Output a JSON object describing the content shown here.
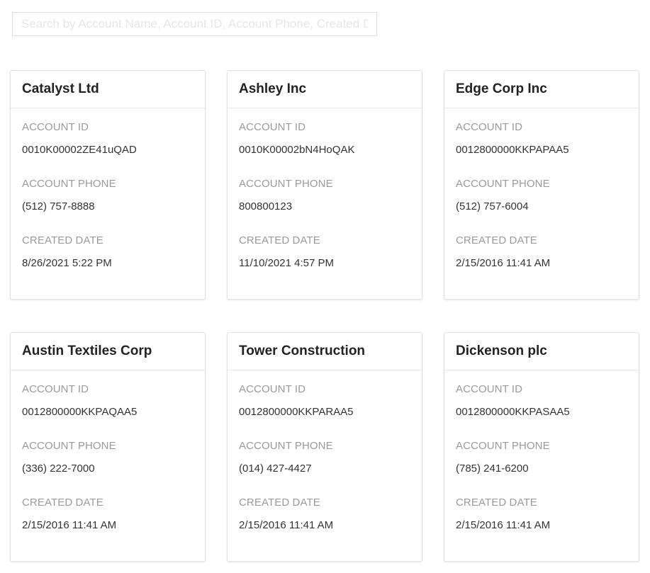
{
  "search": {
    "placeholder": "Search by Account Name, Account ID, Account Phone, Created Date",
    "value": ""
  },
  "labels": {
    "account_id": "ACCOUNT ID",
    "account_phone": "ACCOUNT PHONE",
    "created_date": "CREATED DATE"
  },
  "accounts": [
    {
      "name": "Catalyst Ltd",
      "id": "0010K00002ZE41uQAD",
      "phone": "(512) 757-8888",
      "created": "8/26/2021 5:22 PM"
    },
    {
      "name": "Ashley Inc",
      "id": "0010K00002bN4HoQAK",
      "phone": "800800123",
      "created": "11/10/2021 4:57 PM"
    },
    {
      "name": "Edge Corp Inc",
      "id": "0012800000KKPAPAA5",
      "phone": "(512) 757-6004",
      "created": "2/15/2016 11:41 AM"
    },
    {
      "name": "Austin Textiles Corp",
      "id": "0012800000KKPAQAA5",
      "phone": "(336) 222-7000",
      "created": "2/15/2016 11:41 AM"
    },
    {
      "name": "Tower Construction",
      "id": "0012800000KKPARAA5",
      "phone": "(014) 427-4427",
      "created": "2/15/2016 11:41 AM"
    },
    {
      "name": "Dickenson plc",
      "id": "0012800000KKPASAA5",
      "phone": "(785) 241-6200",
      "created": "2/15/2016 11:41 AM"
    }
  ]
}
